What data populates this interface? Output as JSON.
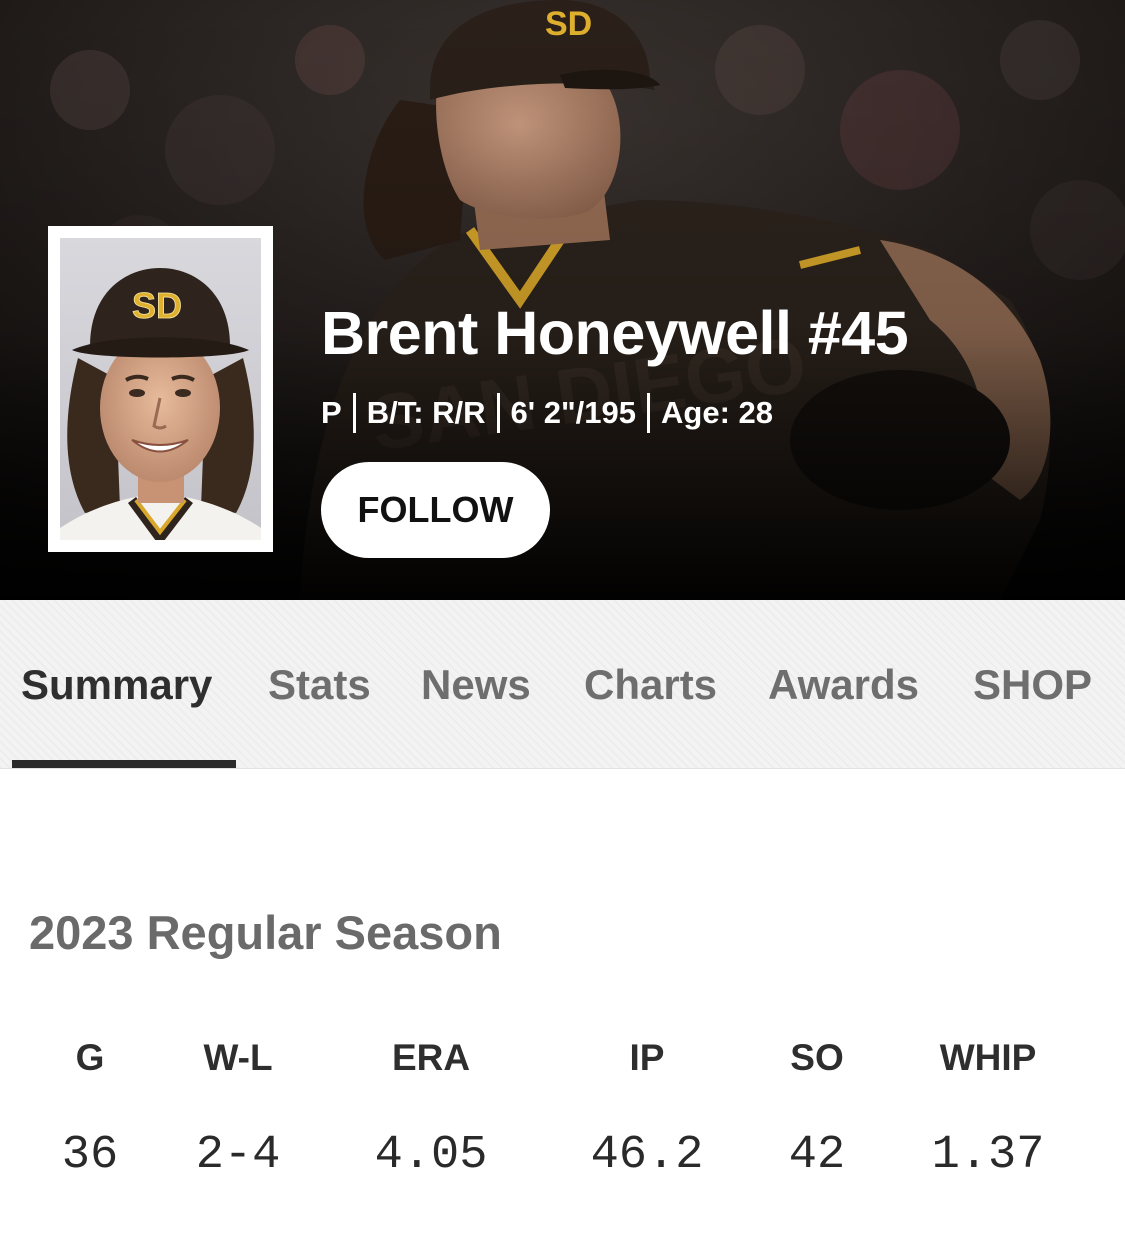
{
  "colors": {
    "hero_background": "#0d0b09",
    "padres_brown": "#2f241d",
    "padres_gold": "#ffc425",
    "active_tab": "#2f2f2f",
    "inactive_tab": "#6e6e6e"
  },
  "hero": {
    "background_image": "pitcher-delivery-photo",
    "headshot_image": "player-headshot",
    "cap_logo": "SD",
    "jersey_text": "SAN DIEGO",
    "player_name": "Brent Honeywell #45",
    "bio": {
      "position": "P",
      "bats_throws": "B/T: R/R",
      "height_weight": "6' 2\"/195",
      "age": "Age: 28"
    },
    "follow_label": "FOLLOW"
  },
  "tabs": [
    {
      "label": "Summary",
      "active": true
    },
    {
      "label": "Stats",
      "active": false
    },
    {
      "label": "News",
      "active": false
    },
    {
      "label": "Charts",
      "active": false
    },
    {
      "label": "Awards",
      "active": false
    },
    {
      "label": "SHOP",
      "active": false
    }
  ],
  "season": {
    "heading": "2023 Regular Season",
    "stats": [
      {
        "label": "G",
        "value": "36"
      },
      {
        "label": "W-L",
        "value": "2-4"
      },
      {
        "label": "ERA",
        "value": "4.05"
      },
      {
        "label": "IP",
        "value": "46.2"
      },
      {
        "label": "SO",
        "value": "42"
      },
      {
        "label": "WHIP",
        "value": "1.37"
      }
    ]
  }
}
